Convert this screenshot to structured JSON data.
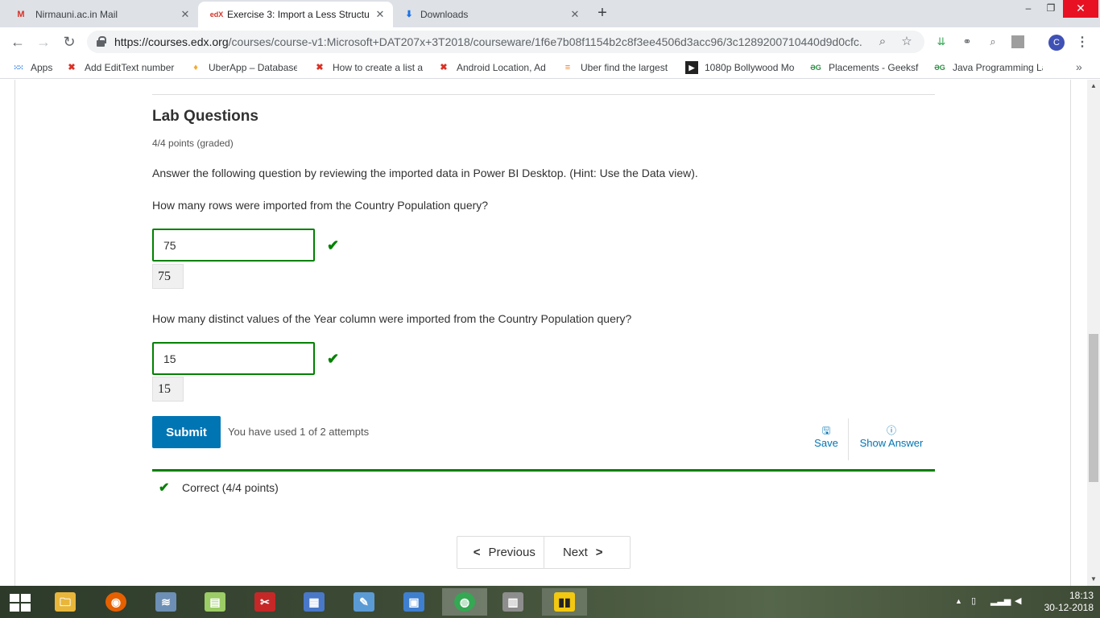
{
  "browser": {
    "tabs": [
      {
        "title": "Nirmauni.ac.in Mail",
        "icon": "gmail-icon",
        "icon_glyph": "M",
        "icon_color": "#d93025"
      },
      {
        "title": "Exercise 3: Import a Less Structur",
        "icon": "edx-icon",
        "icon_glyph": "edX",
        "icon_color": "#d23228"
      },
      {
        "title": "Downloads",
        "icon": "download-icon",
        "icon_glyph": "⬇",
        "icon_color": "#1a73e8"
      }
    ],
    "tab_close_glyph": "✕",
    "new_tab_glyph": "+",
    "url_host": "https://courses.edx.org",
    "url_path": "/courses/course-v1:Microsoft+DAT207x+3T2018/courseware/1f6e7b08f1154b2c8f3ee4506d3acc96/3c1289200710440d9d0cfc...",
    "avatar_letter": "C"
  },
  "bookmarks": [
    {
      "label": "Apps",
      "icon": "apps-icon",
      "glyph": "⋮⋮⋮",
      "color": "#1a73e8"
    },
    {
      "label": "Add EditText number",
      "icon": "x-bookmark-icon",
      "glyph": "✖",
      "color": "#d93025"
    },
    {
      "label": "UberApp – Database",
      "icon": "firebase-icon",
      "glyph": "🔥",
      "color": "#f9a825"
    },
    {
      "label": "How to create a list a",
      "icon": "x-bookmark-icon",
      "glyph": "✖",
      "color": "#d93025"
    },
    {
      "label": "Android Location, Ad",
      "icon": "x-bookmark-icon",
      "glyph": "✖",
      "color": "#d93025"
    },
    {
      "label": "Uber find the largest",
      "icon": "stackoverflow-icon",
      "glyph": "≡",
      "color": "#f48024"
    },
    {
      "label": "1080p Bollywood Mo",
      "icon": "play-icon",
      "glyph": "▶",
      "color": "#222222"
    },
    {
      "label": "Placements - Geeksfo",
      "icon": "geeksforgeeks-icon",
      "glyph": "ƏG",
      "color": "#2f8d46"
    },
    {
      "label": "Java Programming La",
      "icon": "geeksforgeeks-icon",
      "glyph": "ƏG",
      "color": "#2f8d46"
    }
  ],
  "problem": {
    "title": "Lab Questions",
    "points": "4/4 points (graded)",
    "prompt": "Answer the following question by reviewing the imported data in Power BI Desktop. (Hint: Use the Data view).",
    "questions": [
      {
        "text": "How many rows were imported from the Country Population query?",
        "answer": "75",
        "echo": "75"
      },
      {
        "text": "How many distinct values of the Year column were imported from the Country Population query?",
        "answer": "15",
        "echo": "15"
      }
    ],
    "check_glyph": "✔",
    "submit_label": "Submit",
    "attempts": "You have used 1 of 2 attempts",
    "save_label": "Save",
    "show_answer_label": "Show Answer",
    "result": "Correct (4/4 points)"
  },
  "pager": {
    "previous": "Previous",
    "next": "Next"
  },
  "taskbar": {
    "time": "18:13",
    "date": "30-12-2018",
    "apps": [
      {
        "name": "file-explorer-icon",
        "glyph": "🗀",
        "color": "#e8b63a"
      },
      {
        "name": "firefox-icon",
        "glyph": "◉",
        "color": "#e66000"
      },
      {
        "name": "task-manager-icon",
        "glyph": "≋",
        "color": "#6d8fb5"
      },
      {
        "name": "sticky-notes-icon",
        "glyph": "▤",
        "color": "#9ccc65"
      },
      {
        "name": "snipping-tool-icon",
        "glyph": "✂",
        "color": "#c62828"
      },
      {
        "name": "calculator-icon",
        "glyph": "▦",
        "color": "#4a78c8"
      },
      {
        "name": "notepad-icon",
        "glyph": "✎",
        "color": "#5b9bd5"
      },
      {
        "name": "control-panel-icon",
        "glyph": "▣",
        "color": "#3f7fcf"
      },
      {
        "name": "chrome-icon",
        "glyph": "◍",
        "color": "#34a853"
      },
      {
        "name": "remote-desktop-icon",
        "glyph": "▥",
        "color": "#8d8d8d"
      },
      {
        "name": "power-bi-icon",
        "glyph": "▮▮",
        "color": "#f2c811"
      }
    ]
  }
}
